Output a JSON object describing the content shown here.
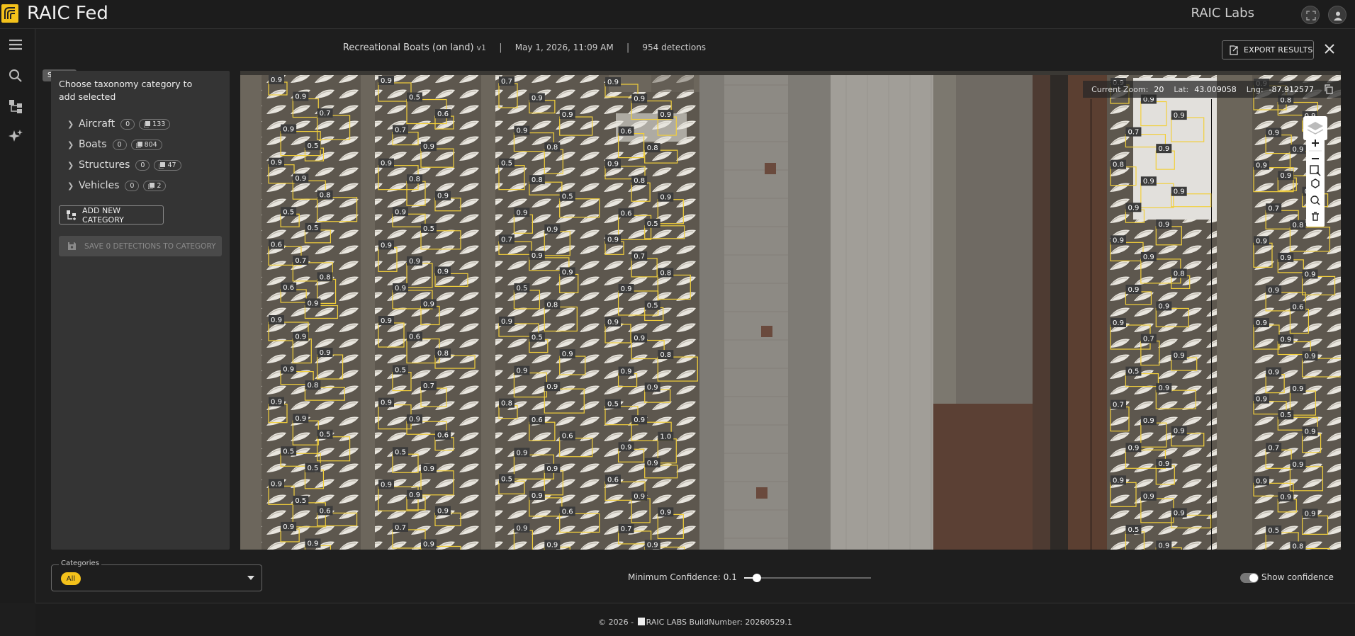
{
  "app": {
    "title": "RAIC Fed",
    "org": "RAIC Labs"
  },
  "tooltip": "Search",
  "header": {
    "search_name": "Recreational Boats (on land)",
    "version": "v1",
    "date": "May 1, 2026, 11:09 AM",
    "detections": "954 detections",
    "export_label": "EXPORT RESULTS"
  },
  "panel": {
    "hint": "Choose taxonomy category to add selected",
    "categories": [
      {
        "label": "Aircraft",
        "selected": "0",
        "count": "133"
      },
      {
        "label": "Boats",
        "selected": "0",
        "count": "804"
      },
      {
        "label": "Structures",
        "selected": "0",
        "count": "47"
      },
      {
        "label": "Vehicles",
        "selected": "0",
        "count": "2"
      }
    ],
    "add_label": "ADD NEW CATEGORY",
    "save_label": "SAVE 0 DETECTIONS TO CATEGORY"
  },
  "readout": {
    "zoom_label": "Current Zoom:",
    "zoom": "20",
    "lat_label": "Lat:",
    "lat": "43.009058",
    "lng_label": "Lng:",
    "lng": "-87.912577"
  },
  "bottom": {
    "categories_legend": "Categories",
    "chip": "All",
    "confidence_label": "Minimum Confidence: 0.1",
    "confidence_value": 0.1,
    "show_confidence": "Show confidence",
    "show_confidence_on": true
  },
  "footer": {
    "prefix": "© 2026 -",
    "brand": "RAIC LABS",
    "build": "BuildNumber: 20260529.1"
  },
  "map_labels": [
    "0.9",
    "0.9",
    "0.7",
    "0.9",
    "0.5",
    "0.9",
    "0.9",
    "0.8",
    "0.5",
    "0.5",
    "0.6",
    "0.7",
    "0.8",
    "0.6",
    "0.9",
    "0.9",
    "0.9",
    "0.9",
    "0.9",
    "0.8",
    "0.9",
    "0.9",
    "0.5",
    "0.5",
    "0.5",
    "0.9",
    "0.5",
    "0.6",
    "0.9",
    "0.9",
    "0.9",
    "0.5",
    "0.6",
    "0.7",
    "0.9",
    "0.9",
    "0.8",
    "0.9",
    "0.9",
    "0.5",
    "0.9",
    "0.9",
    "0.9",
    "0.9",
    "0.9",
    "0.9",
    "0.6",
    "0.8",
    "0.5",
    "0.7",
    "0.9",
    "0.9",
    "0.6",
    "0.5",
    "0.9",
    "0.9",
    "0.9",
    "0.9",
    "0.7",
    "0.9",
    "0.7",
    "0.9",
    "0.9",
    "0.9",
    "0.8",
    "0.5",
    "0.8",
    "0.5",
    "0.9",
    "0.9",
    "0.7",
    "0.9",
    "0.9",
    "0.5",
    "0.8",
    "0.9",
    "0.5",
    "0.9",
    "0.9",
    "0.9",
    "0.8",
    "0.6",
    "0.6",
    "0.9",
    "0.9",
    "0.5",
    "0.9",
    "0.6",
    "0.9",
    "0.9",
    "0.9",
    "0.9",
    "0.9",
    "0.6",
    "0.8",
    "0.9",
    "0.8",
    "0.9",
    "0.6",
    "0.5",
    "0.9",
    "0.7",
    "0.8",
    "0.9",
    "0.5",
    "0.9",
    "0.9",
    "0.8",
    "0.9",
    "0.9",
    "0.5",
    "0.9",
    "1.0",
    "0.9",
    "0.9",
    "0.6",
    "0.9",
    "0.9",
    "0.7",
    "0.9",
    "0.9",
    "0.9",
    "0.9",
    "0.7",
    "0.9",
    "0.8",
    "0.9",
    "0.9",
    "0.9",
    "0.9",
    "0.9",
    "0.9",
    "0.8",
    "0.9",
    "0.9",
    "0.9",
    "0.7",
    "0.9",
    "0.5",
    "0.9",
    "0.7",
    "0.9",
    "0.9",
    "0.9",
    "0.9",
    "0.9",
    "0.9",
    "0.9",
    "0.5",
    "0.9",
    "0.9",
    "0.8",
    "0.9",
    "0.9",
    "0.9",
    "0.9",
    "0.9",
    "0.8",
    "0.7",
    "0.8",
    "0.9",
    "0.9",
    "0.9",
    "0.9",
    "0.6",
    "0.9",
    "0.9",
    "0.9",
    "0.9",
    "0.9",
    "0.9",
    "0.5",
    "0.9",
    "0.7",
    "0.9",
    "0.9",
    "0.9",
    "0.9",
    "0.5",
    "0.8"
  ]
}
